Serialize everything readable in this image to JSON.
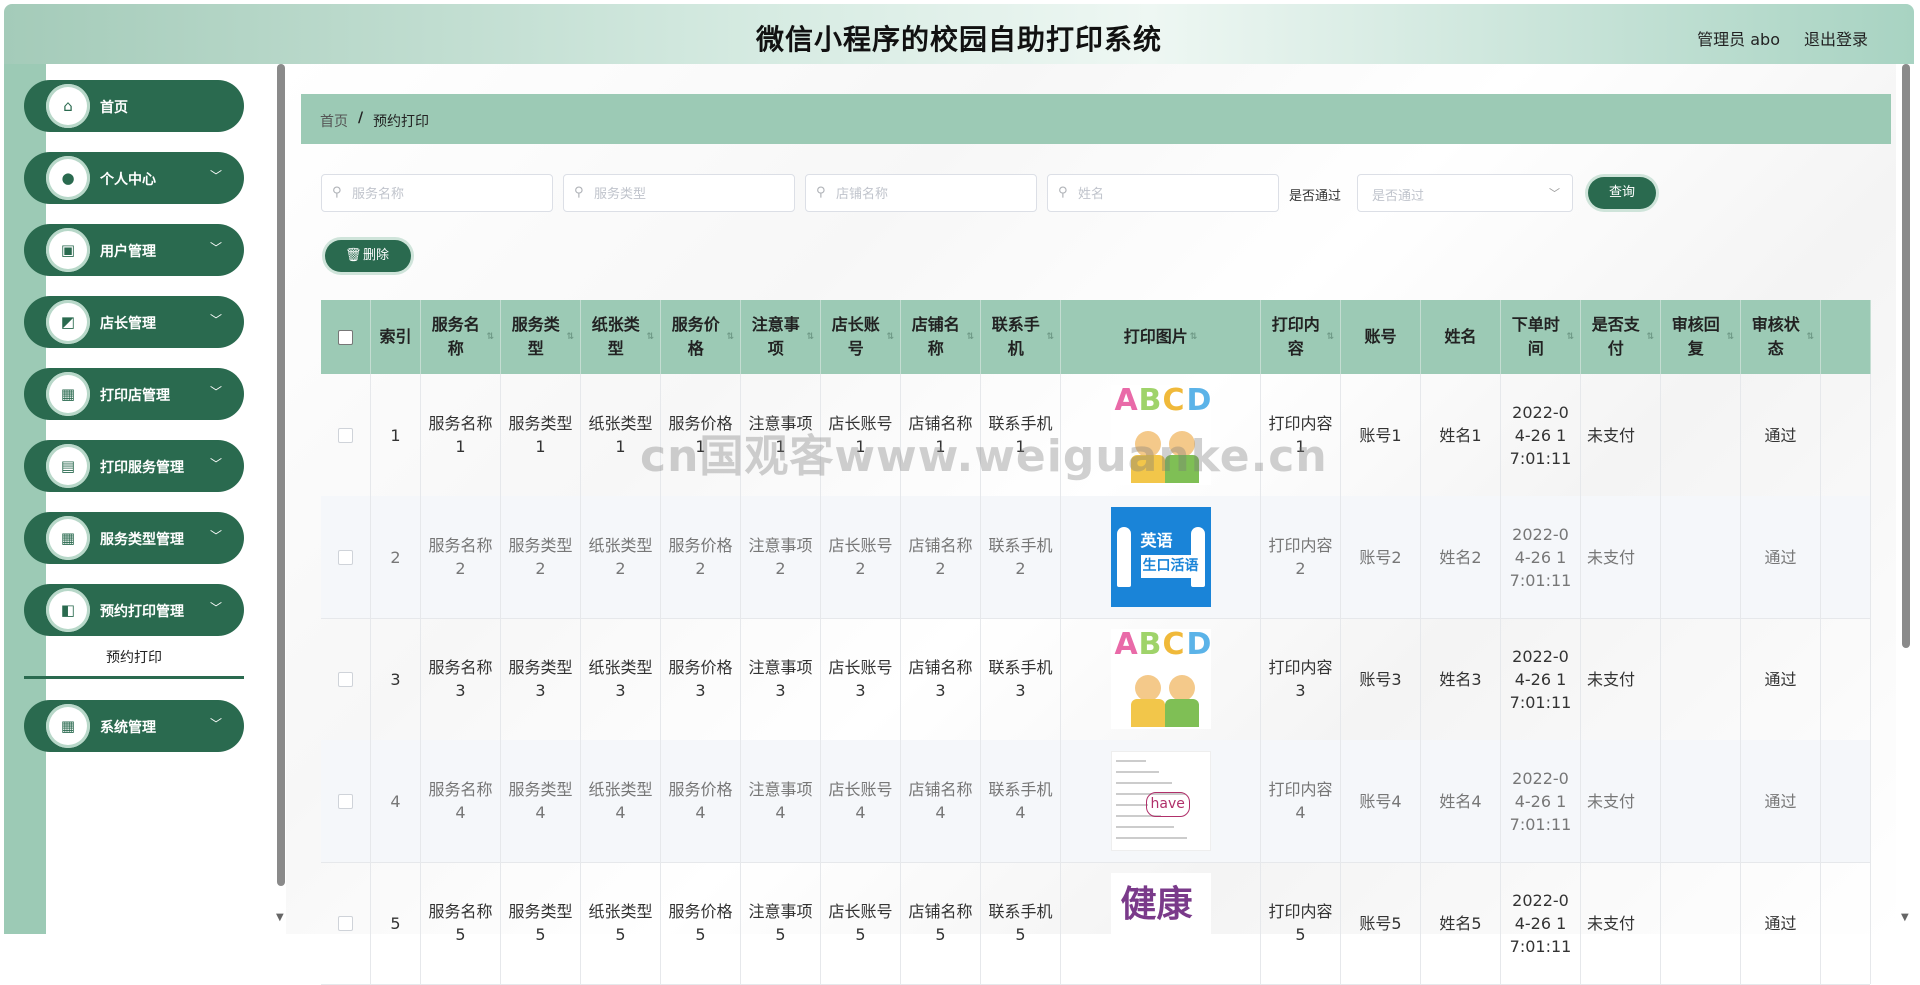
{
  "header": {
    "title": "微信小程序的校园自助打印系统",
    "user_label": "管理员 abo",
    "logout_label": "退出登录"
  },
  "sidebar": {
    "items": [
      {
        "label": "首页",
        "icon": "home-icon",
        "has_children": false
      },
      {
        "label": "个人中心",
        "icon": "user-icon",
        "has_children": true
      },
      {
        "label": "用户管理",
        "icon": "briefcase-icon",
        "has_children": true
      },
      {
        "label": "店长管理",
        "icon": "chart-icon",
        "has_children": true
      },
      {
        "label": "打印店管理",
        "icon": "grid-icon",
        "has_children": true
      },
      {
        "label": "打印服务管理",
        "icon": "clipboard-icon",
        "has_children": true
      },
      {
        "label": "服务类型管理",
        "icon": "grid-icon",
        "has_children": true
      },
      {
        "label": "预约打印管理",
        "icon": "wallet-icon",
        "has_children": true,
        "expanded": true
      },
      {
        "label": "系统管理",
        "icon": "grid-icon",
        "has_children": true
      }
    ],
    "submenu": {
      "label": "预约打印",
      "active": true
    }
  },
  "breadcrumb": {
    "home": "首页",
    "separator": "/",
    "current": "预约打印"
  },
  "filters": {
    "service_name_placeholder": "服务名称",
    "service_type_placeholder": "服务类型",
    "shop_name_placeholder": "店铺名称",
    "name_placeholder": "姓名",
    "pass_label": "是否通过",
    "pass_placeholder": "是否通过",
    "query_label": "查询",
    "delete_label": "删除"
  },
  "table": {
    "columns": [
      "索引",
      "服务名称",
      "服务类型",
      "纸张类型",
      "服务价格",
      "注意事项",
      "店长账号",
      "店铺名称",
      "联系手机",
      "打印图片",
      "打印内容",
      "账号",
      "姓名",
      "下单时间",
      "是否支付",
      "审核回复",
      "审核状态"
    ],
    "rows": [
      {
        "index": "1",
        "service_name": "服务名称1",
        "service_type": "服务类型1",
        "paper_type": "纸张类型1",
        "price": "服务价格1",
        "notes": "注意事项1",
        "manager_account": "店长账号1",
        "shop_name": "店铺名称1",
        "phone": "联系手机1",
        "image": "abcd",
        "content": "打印内容1",
        "account": "账号1",
        "name": "姓名1",
        "order_time": "2022-04-26 17:01:11",
        "paid": "未支付",
        "reply": "",
        "status": "通过"
      },
      {
        "index": "2",
        "service_name": "服务名称2",
        "service_type": "服务类型2",
        "paper_type": "纸张类型2",
        "price": "服务价格2",
        "notes": "注意事项2",
        "manager_account": "店长账号2",
        "shop_name": "店铺名称2",
        "phone": "联系手机2",
        "image": "english",
        "content": "打印内容2",
        "account": "账号2",
        "name": "姓名2",
        "order_time": "2022-04-26 17:01:11",
        "paid": "未支付",
        "reply": "",
        "status": "通过"
      },
      {
        "index": "3",
        "service_name": "服务名称3",
        "service_type": "服务类型3",
        "paper_type": "纸张类型3",
        "price": "服务价格3",
        "notes": "注意事项3",
        "manager_account": "店长账号3",
        "shop_name": "店铺名称3",
        "phone": "联系手机3",
        "image": "abcd",
        "content": "打印内容3",
        "account": "账号3",
        "name": "姓名3",
        "order_time": "2022-04-26 17:01:11",
        "paid": "未支付",
        "reply": "",
        "status": "通过"
      },
      {
        "index": "4",
        "service_name": "服务名称4",
        "service_type": "服务类型4",
        "paper_type": "纸张类型4",
        "price": "服务价格4",
        "notes": "注意事项4",
        "manager_account": "店长账号4",
        "shop_name": "店铺名称4",
        "phone": "联系手机4",
        "image": "have",
        "content": "打印内容4",
        "account": "账号4",
        "name": "姓名4",
        "order_time": "2022-04-26 17:01:11",
        "paid": "未支付",
        "reply": "",
        "status": "通过"
      },
      {
        "index": "5",
        "service_name": "服务名称5",
        "service_type": "服务类型5",
        "paper_type": "纸张类型5",
        "price": "服务价格5",
        "notes": "注意事项5",
        "manager_account": "店长账号5",
        "shop_name": "店铺名称5",
        "phone": "联系手机5",
        "image": "calligraphy",
        "content": "打印内容5",
        "account": "账号5",
        "name": "姓名5",
        "order_time": "2022-04-26 17:01:11",
        "paid": "未支付",
        "reply": "",
        "status": "通过"
      }
    ]
  },
  "images": {
    "abcd_letters": [
      "A",
      "B",
      "C",
      "D"
    ],
    "english_text1": "英语",
    "english_text2": "生口活语",
    "have_text": "have",
    "calligraphy_text": "健康"
  },
  "watermark": "cn国观客www.weiguanke.cn",
  "colors": {
    "primary": "#2a6a4f",
    "header_green": "#9ccab5"
  }
}
